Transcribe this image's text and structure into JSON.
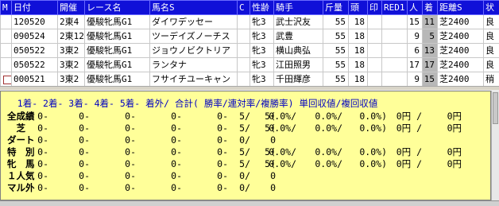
{
  "race_table": {
    "columns": [
      "M",
      "日付",
      "開催",
      "レース名",
      "馬名S",
      "C",
      "性齢",
      "騎手",
      "斤量",
      "頭",
      "印",
      "RED1",
      "人",
      "着",
      "距離S",
      "状"
    ],
    "rows": [
      {
        "date": "120520",
        "place": "2東4",
        "race": "優駿牝馬G1",
        "horse": "ダイワデッセー",
        "sex": "牝3",
        "jockey": "武士沢友",
        "weight": "55",
        "heads": "18",
        "pop": "15",
        "rank": "11",
        "dist": "芝2400",
        "cond": "良"
      },
      {
        "date": "090524",
        "place": "2東12",
        "race": "優駿牝馬G1",
        "horse": "ツーデイズノーチス",
        "sex": "牝3",
        "jockey": "武豊",
        "weight": "55",
        "heads": "18",
        "pop": "9",
        "rank": "5",
        "dist": "芝2400",
        "cond": "良"
      },
      {
        "date": "050522",
        "place": "3東2",
        "race": "優駿牝馬G1",
        "horse": "ジョウノビクトリア",
        "sex": "牝3",
        "jockey": "横山典弘",
        "weight": "55",
        "heads": "18",
        "pop": "6",
        "rank": "13",
        "dist": "芝2400",
        "cond": "良"
      },
      {
        "date": "050522",
        "place": "3東2",
        "race": "優駿牝馬G1",
        "horse": "ランタナ",
        "sex": "牝3",
        "jockey": "江田照男",
        "weight": "55",
        "heads": "18",
        "pop": "17",
        "rank": "17",
        "dist": "芝2400",
        "cond": "良"
      },
      {
        "date": "000521",
        "place": "3東2",
        "race": "優駿牝馬G1",
        "horse": "フサイチユーキャン",
        "sex": "牝3",
        "jockey": "千田輝彦",
        "weight": "55",
        "heads": "18",
        "pop": "9",
        "rank": "15",
        "dist": "芝2400",
        "cond": "稍"
      }
    ]
  },
  "stats": {
    "header": "   1着- 2着- 3着- 4着- 5着- 着外/ 合計( 勝率/連対率/複勝率) 単回収値/複回収値",
    "rows": [
      {
        "label": "全成績",
        "c1": "0-",
        "c2": "0-",
        "c3": "0-",
        "c4": "0-",
        "c5": "0-",
        "out": "5/",
        "total": "5(",
        "win": "0.0%/",
        "ren": "0.0%/",
        "fuku": "0.0%)",
        "tan": "0円 /",
        "fukukai": "0円"
      },
      {
        "label": "　芝",
        "c1": "0-",
        "c2": "0-",
        "c3": "0-",
        "c4": "0-",
        "c5": "0-",
        "out": "5/",
        "total": "5(",
        "win": "0.0%/",
        "ren": "0.0%/",
        "fuku": "0.0%)",
        "tan": "0円 /",
        "fukukai": "0円"
      },
      {
        "label": "ダート",
        "c1": "0-",
        "c2": "0-",
        "c3": "0-",
        "c4": "0-",
        "c5": "0-",
        "out": "0/",
        "total": "0",
        "win": "",
        "ren": "",
        "fuku": "",
        "tan": "",
        "fukukai": ""
      },
      {
        "label": "特　別",
        "c1": "0-",
        "c2": "0-",
        "c3": "0-",
        "c4": "0-",
        "c5": "0-",
        "out": "5/",
        "total": "5(",
        "win": "0.0%/",
        "ren": "0.0%/",
        "fuku": "0.0%)",
        "tan": "0円 /",
        "fukukai": "0円"
      },
      {
        "label": "牝　馬",
        "c1": "0-",
        "c2": "0-",
        "c3": "0-",
        "c4": "0-",
        "c5": "0-",
        "out": "5/",
        "total": "5(",
        "win": "0.0%/",
        "ren": "0.0%/",
        "fuku": "0.0%)",
        "tan": "0円 /",
        "fukukai": "0円"
      },
      {
        "label": "１人気",
        "c1": "0-",
        "c2": "0-",
        "c3": "0-",
        "c4": "0-",
        "c5": "0-",
        "out": "0/",
        "total": "0",
        "win": "",
        "ren": "",
        "fuku": "",
        "tan": "",
        "fukukai": ""
      },
      {
        "label": "マル外",
        "c1": "0-",
        "c2": "0-",
        "c3": "0-",
        "c4": "0-",
        "c5": "0-",
        "out": "0/",
        "total": "0",
        "win": "",
        "ren": "",
        "fuku": "",
        "tan": "",
        "fukukai": ""
      }
    ]
  },
  "colors": {
    "header_bg": "#1010d8",
    "stats_bg": "#ffff99",
    "rank_bg": "#b8b8b8"
  }
}
